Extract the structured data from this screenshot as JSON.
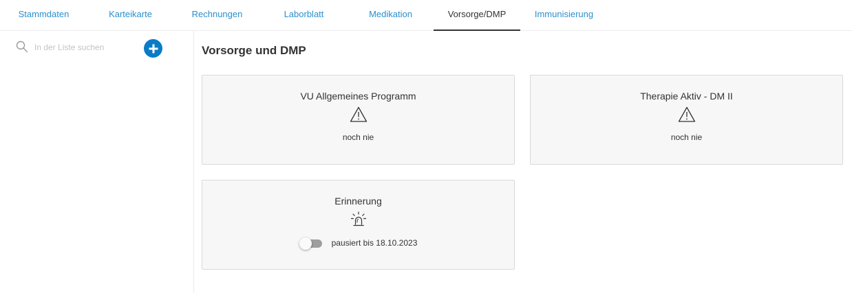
{
  "tabs": [
    {
      "label": "Stammdaten",
      "active": false
    },
    {
      "label": "Karteikarte",
      "active": false
    },
    {
      "label": "Rechnungen",
      "active": false
    },
    {
      "label": "Laborblatt",
      "active": false
    },
    {
      "label": "Medikation",
      "active": false
    },
    {
      "label": "Vorsorge/DMP",
      "active": true
    },
    {
      "label": "Immunisierung",
      "active": false
    }
  ],
  "sidebar": {
    "search_placeholder": "In der Liste suchen",
    "search_value": "",
    "search_icon": "search-icon",
    "add_icon": "plus-icon"
  },
  "main": {
    "title": "Vorsorge und DMP",
    "cards": [
      {
        "title": "VU Allgemeines Programm",
        "icon": "warning-icon",
        "status": "noch nie"
      },
      {
        "title": "Therapie Aktiv - DM II",
        "icon": "warning-icon",
        "status": "noch nie"
      }
    ],
    "reminder": {
      "title": "Erinnerung",
      "icon": "alarm-light-icon",
      "toggle_on": false,
      "status": "pausiert bis 18.10.2023"
    }
  },
  "colors": {
    "accent": "#2a8fce",
    "add_button": "#0a7cc7",
    "card_bg": "#f7f7f7",
    "card_border": "#d9d9d9"
  }
}
